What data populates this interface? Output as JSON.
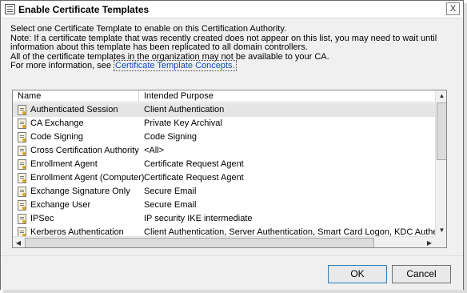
{
  "window": {
    "title": "Enable Certificate Templates",
    "close_label": "X"
  },
  "intro": {
    "line1": "Select one Certificate Template to enable on this Certification Authority.",
    "line2": "Note: If a certificate template that was recently created does not appear on this list, you may need to wait until",
    "line3": "information about this template has been replicated to all domain controllers.",
    "line4": "All of the certificate templates in the organization may not be available to your CA.",
    "line5_prefix": "For more information, see ",
    "link": "Certificate Template Concepts."
  },
  "list": {
    "columns": {
      "name": "Name",
      "purpose": "Intended Purpose"
    },
    "rows": [
      {
        "name": "Authenticated Session",
        "purpose": "Client Authentication",
        "selected": true
      },
      {
        "name": "CA Exchange",
        "purpose": "Private Key Archival"
      },
      {
        "name": "Code Signing",
        "purpose": "Code Signing"
      },
      {
        "name": "Cross Certification Authority",
        "purpose": "<All>"
      },
      {
        "name": "Enrollment Agent",
        "purpose": "Certificate Request Agent"
      },
      {
        "name": "Enrollment Agent (Computer)",
        "purpose": "Certificate Request Agent"
      },
      {
        "name": "Exchange Signature Only",
        "purpose": "Secure Email"
      },
      {
        "name": "Exchange User",
        "purpose": "Secure Email"
      },
      {
        "name": "IPSec",
        "purpose": "IP security IKE intermediate"
      },
      {
        "name": "Kerberos Authentication",
        "purpose": "Client Authentication, Server Authentication, Smart Card Logon, KDC Authentication"
      }
    ],
    "icon": "certificate-template-icon"
  },
  "buttons": {
    "ok": "OK",
    "cancel": "Cancel"
  }
}
